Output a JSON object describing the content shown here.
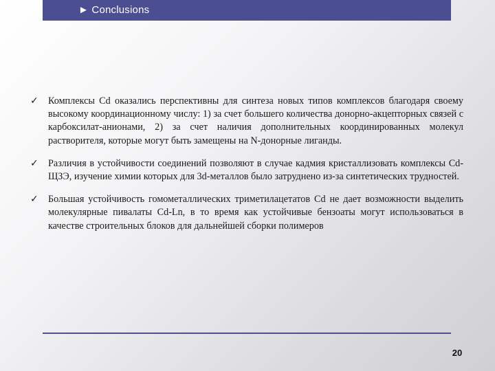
{
  "header": {
    "title": "► Conclusions"
  },
  "bullets": [
    {
      "icon": "check-icon",
      "mark": "✓",
      "text": "Комплексы Cd оказались перспективны для синтеза новых типов комплексов благодаря своему высокому координационному числу: 1) за счет большего количества донорно-акцепторных связей с карбоксилат-анионами, 2) за счет наличия дополнительных координированных молекул растворителя, которые могут быть замещены на N-донорные лиганды."
    },
    {
      "icon": "check-icon",
      "mark": "✓",
      "text": "Различия в устойчивости соединений позволяют в случае кадмия кристаллизовать комплексы Cd-ЩЗЭ, изучение химии которых для 3d-металлов было затруднено из-за синтетических трудностей."
    },
    {
      "icon": "check-icon",
      "mark": "✓",
      "text": "Большая устойчивость гомометаллических триметилацетатов Cd не дает возможности выделить молекулярные пивалаты Cd-Ln, в то время как устойчивые бензоаты могут использоваться в качестве строительных блоков для дальнейшей сборки полимеров"
    }
  ],
  "footer": {
    "page_number": "20"
  },
  "colors": {
    "accent": "#4b4f91",
    "text": "#1a1a1a"
  }
}
